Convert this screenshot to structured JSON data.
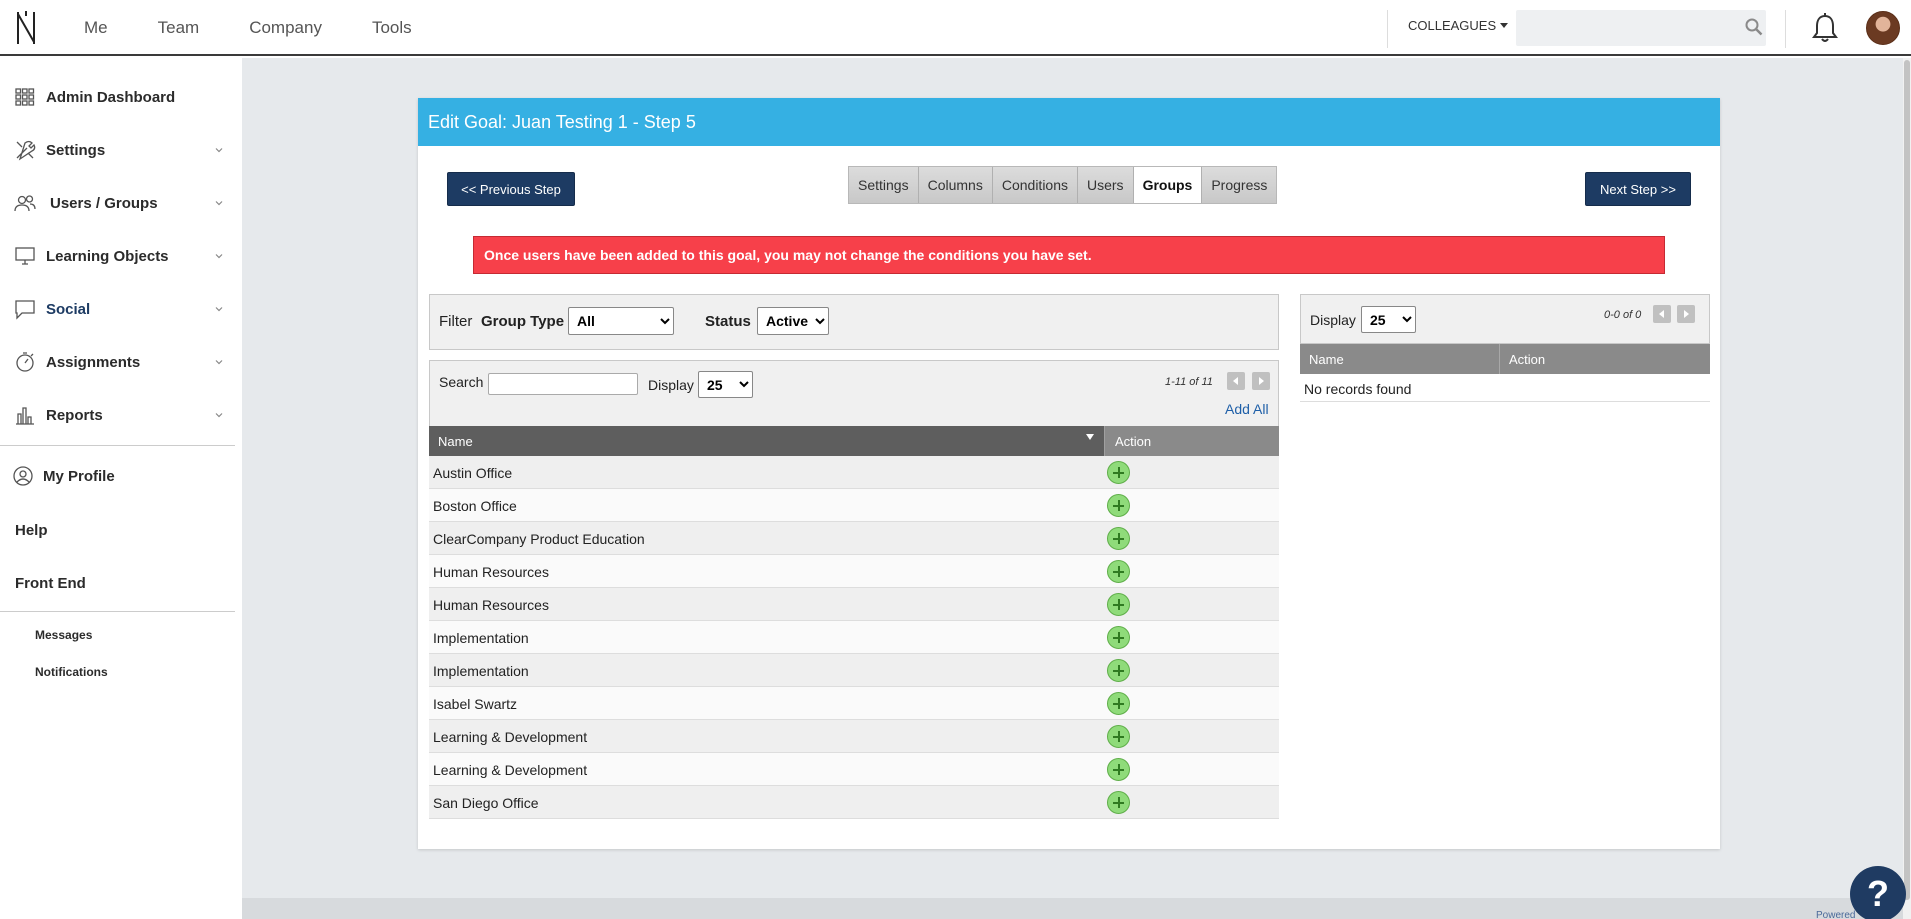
{
  "topnav": {
    "items": [
      "Me",
      "Team",
      "Company",
      "Tools"
    ],
    "colleagues_label": "COLLEAGUES",
    "search_placeholder": ""
  },
  "sidebar": {
    "items": [
      {
        "label": "Admin Dashboard",
        "icon": "dashboard-grid-icon"
      },
      {
        "label": "Settings",
        "icon": "tools-icon"
      },
      {
        "label": "Users / Groups",
        "icon": "users-icon"
      },
      {
        "label": "Learning Objects",
        "icon": "monitor-icon"
      },
      {
        "label": "Social",
        "icon": "chat-icon"
      },
      {
        "label": "Assignments",
        "icon": "stopwatch-icon"
      },
      {
        "label": "Reports",
        "icon": "bar-chart-icon"
      }
    ],
    "my_profile": "My Profile",
    "help": "Help",
    "front_end": "Front End",
    "messages": "Messages",
    "notifications": "Notifications"
  },
  "page": {
    "title": "Edit Goal: Juan Testing 1 - Step 5",
    "prev_label": "<< Previous Step",
    "next_label": "Next Step >>",
    "steps": [
      "Settings",
      "Columns",
      "Conditions",
      "Users",
      "Groups",
      "Progress"
    ],
    "active_step": "Groups",
    "alert": "Once users have been added to this goal, you may not change the conditions you have set."
  },
  "filter": {
    "filter_label": "Filter",
    "group_type_label": "Group Type",
    "group_type_value": "All",
    "status_label": "Status",
    "status_value": "Active"
  },
  "available": {
    "search_label": "Search",
    "display_label": "Display",
    "display_value": "25",
    "pager": "1-11 of 11",
    "add_all": "Add All",
    "col_name": "Name",
    "col_action": "Action",
    "rows": [
      "Austin Office",
      "Boston Office",
      "ClearCompany Product Education",
      "Human Resources",
      "Human Resources",
      "Implementation",
      "Implementation",
      "Isabel Swartz",
      "Learning & Development",
      "Learning & Development",
      "San Diego Office"
    ]
  },
  "selected": {
    "display_label": "Display",
    "display_value": "25",
    "pager": "0-0 of 0",
    "col_name": "Name",
    "col_action": "Action",
    "empty": "No records found"
  },
  "footer": {
    "powered": "Powered",
    "help_glyph": "?"
  }
}
